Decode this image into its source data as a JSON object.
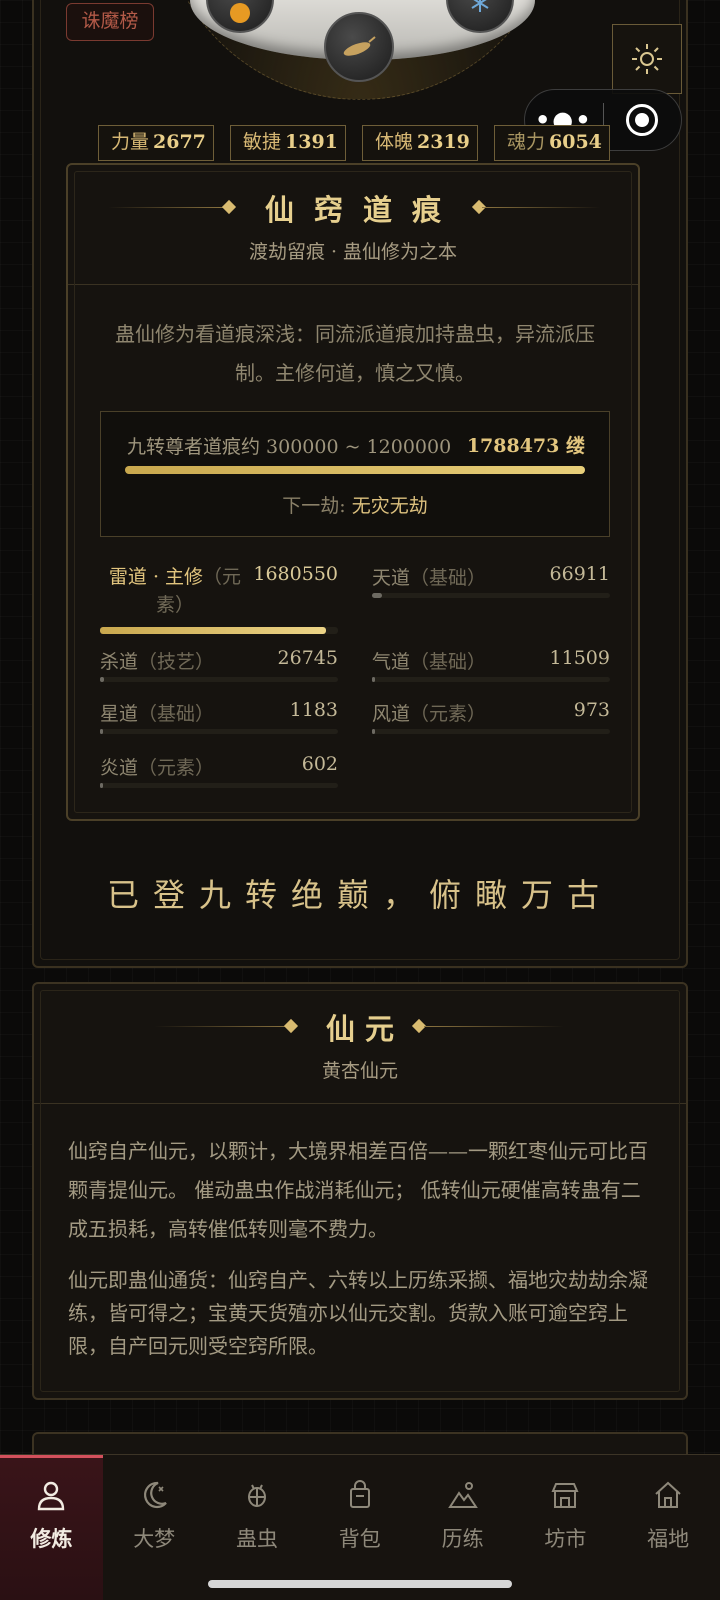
{
  "top": {
    "rank_tag": "诛魔榜",
    "stats": [
      {
        "label": "力量",
        "value": "2677"
      },
      {
        "label": "敏捷",
        "value": "1391"
      },
      {
        "label": "体魄",
        "value": "2319"
      },
      {
        "label": "魂力",
        "value": "6054"
      }
    ]
  },
  "aperture": {
    "title": "仙窍道痕",
    "subtitle": "渡劫留痕 · 蛊仙修为之本",
    "description": "蛊仙修为看道痕深浅：同流派道痕加持蛊虫，异流派压制。主修何道，慎之又慎。",
    "realm_label": "九转尊者道痕约 300000 ~ 1200000",
    "realm_value": "1788473 缕",
    "realm_progress": 1.0,
    "next_label": "下一劫:",
    "next_value": "无灾无劫",
    "daos": [
      {
        "name": "雷道 · 主修",
        "tag": "（元素）",
        "value": "1680550",
        "progress": 0.95,
        "main": true
      },
      {
        "name": "天道",
        "tag": "（基础）",
        "value": "66911",
        "progress": 0.04
      },
      {
        "name": "杀道",
        "tag": "（技艺）",
        "value": "26745",
        "progress": 0.016
      },
      {
        "name": "气道",
        "tag": "（基础）",
        "value": "11509",
        "progress": 0.007
      },
      {
        "name": "星道",
        "tag": "（基础）",
        "value": "1183",
        "progress": 0.001
      },
      {
        "name": "风道",
        "tag": "（元素）",
        "value": "973",
        "progress": 0.001
      },
      {
        "name": "炎道",
        "tag": "（元素）",
        "value": "602",
        "progress": 0.0005
      }
    ],
    "summit": "已登九转绝巅，俯瞰万古"
  },
  "immortal_essence": {
    "title": "仙元",
    "subtitle": "黄杏仙元",
    "paragraph1": "仙窍自产仙元，以颗计，大境界相差百倍——一颗红枣仙元可比百颗青提仙元。 催动蛊虫作战消耗仙元； 低转仙元硬催高转蛊有二成五损耗，高转催低转则毫不费力。",
    "paragraph2": "仙元即蛊仙通货：仙窍自产、六转以上历练采撷、福地灾劫劫余凝练，皆可得之；宝黄天货殖亦以仙元交割。货款入账可逾空窍上限，自产回元则受空窍所限。"
  },
  "tabs": [
    {
      "label": "修炼",
      "icon": "person-icon",
      "active": true
    },
    {
      "label": "大梦",
      "icon": "moon-icon"
    },
    {
      "label": "蛊虫",
      "icon": "bug-icon"
    },
    {
      "label": "背包",
      "icon": "bag-icon"
    },
    {
      "label": "历练",
      "icon": "mountain-icon"
    },
    {
      "label": "坊市",
      "icon": "shop-icon"
    },
    {
      "label": "福地",
      "icon": "home-icon"
    }
  ],
  "colors": {
    "gold": "#e6cf8e",
    "active_tab": "#d3505c",
    "background": "#0b0a09"
  }
}
